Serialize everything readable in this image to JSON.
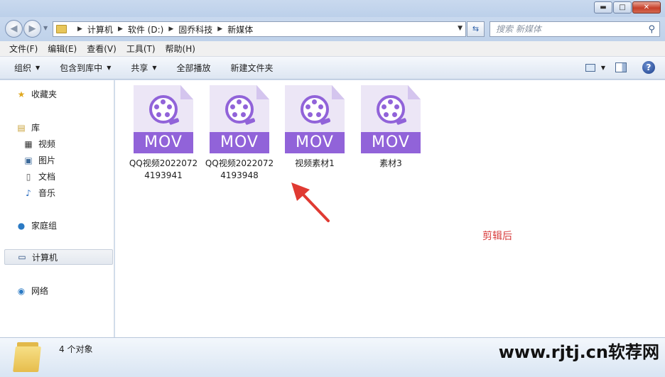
{
  "window": {
    "minimize_glyph": "▬",
    "maximize_glyph": "□",
    "close_glyph": "✕"
  },
  "address": {
    "breadcrumbs": [
      "计算机",
      "软件 (D:)",
      "固乔科技",
      "新媒体"
    ],
    "search_placeholder": "搜索 新媒体"
  },
  "menu": [
    "文件(F)",
    "编辑(E)",
    "查看(V)",
    "工具(T)",
    "帮助(H)"
  ],
  "commands": {
    "organize": "组织",
    "include_library": "包含到库中",
    "share": "共享",
    "play_all": "全部播放",
    "new_folder": "新建文件夹"
  },
  "sidebar": {
    "favorites": "收藏夹",
    "library": "库",
    "videos": "视频",
    "pictures": "图片",
    "documents": "文档",
    "music": "音乐",
    "homegroup": "家庭组",
    "computer": "计算机",
    "network": "网络"
  },
  "files": [
    {
      "badge": "MOV",
      "name": "QQ视频20220724193941"
    },
    {
      "badge": "MOV",
      "name": "QQ视频20220724193948"
    },
    {
      "badge": "MOV",
      "name": "视频素材1"
    },
    {
      "badge": "MOV",
      "name": "素材3"
    }
  ],
  "annotation": "剪辑后",
  "status": {
    "count": "4 个对象"
  },
  "watermark": "www.rjtj.cn软荐网",
  "colors": {
    "mov_accent": "#9163d9",
    "annotation": "#d83c3c"
  }
}
